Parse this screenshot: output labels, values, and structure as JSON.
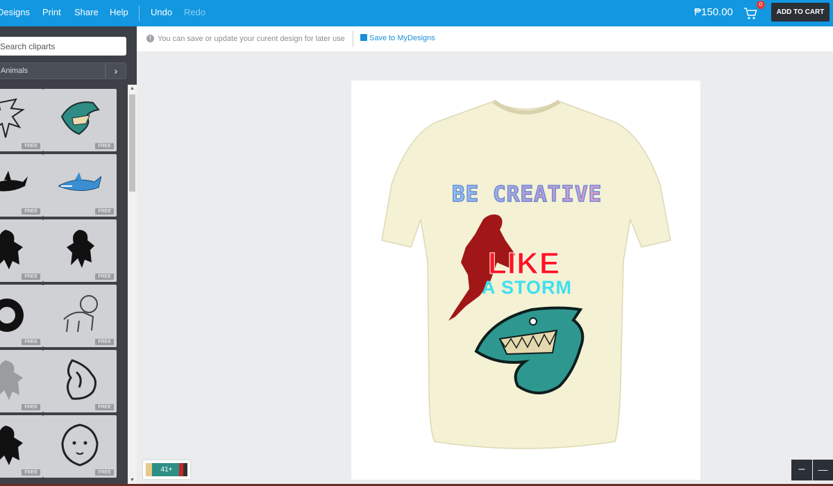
{
  "menu": {
    "designs": "Designs",
    "print": "Print",
    "share": "Share",
    "help": "Help",
    "undo": "Undo",
    "redo": "Redo"
  },
  "cart": {
    "price": "₱150.00",
    "count": "0",
    "add_to_cart": "ADD TO CART"
  },
  "sidebar": {
    "search_placeholder": "Search cliparts",
    "category": "Animals",
    "cliparts": [
      {
        "label": "FREE",
        "icon": "dragon-sketch-icon"
      },
      {
        "label": "FREE",
        "icon": "shark-mascot-teal-icon"
      },
      {
        "label": "FREE",
        "icon": "shark-black-icon"
      },
      {
        "label": "FREE",
        "icon": "shark-blue-icon"
      },
      {
        "label": "FREE",
        "icon": "lion-rampant-icon"
      },
      {
        "label": "FREE",
        "icon": "lion-rampant-2-icon"
      },
      {
        "label": "FREE",
        "icon": "lion-head-tribal-icon"
      },
      {
        "label": "FREE",
        "icon": "lion-walking-icon"
      },
      {
        "label": "FREE",
        "icon": "lion-grey-icon"
      },
      {
        "label": "FREE",
        "icon": "lion-tribal-icon"
      },
      {
        "label": "FREE",
        "icon": "lion-rampant-3-icon"
      },
      {
        "label": "FREE",
        "icon": "lion-face-icon"
      }
    ]
  },
  "infobar": {
    "message": "You can save or update your curent design for later use",
    "save_link": "Save to MyDesigns"
  },
  "design": {
    "line1": "BE CREATIVE",
    "line2": "LIKE",
    "line3": "A STORM",
    "shirt_color": "#f4f1d4"
  },
  "colors": {
    "count": "41+"
  },
  "zoom": {
    "minus": "–",
    "bar": "—"
  }
}
